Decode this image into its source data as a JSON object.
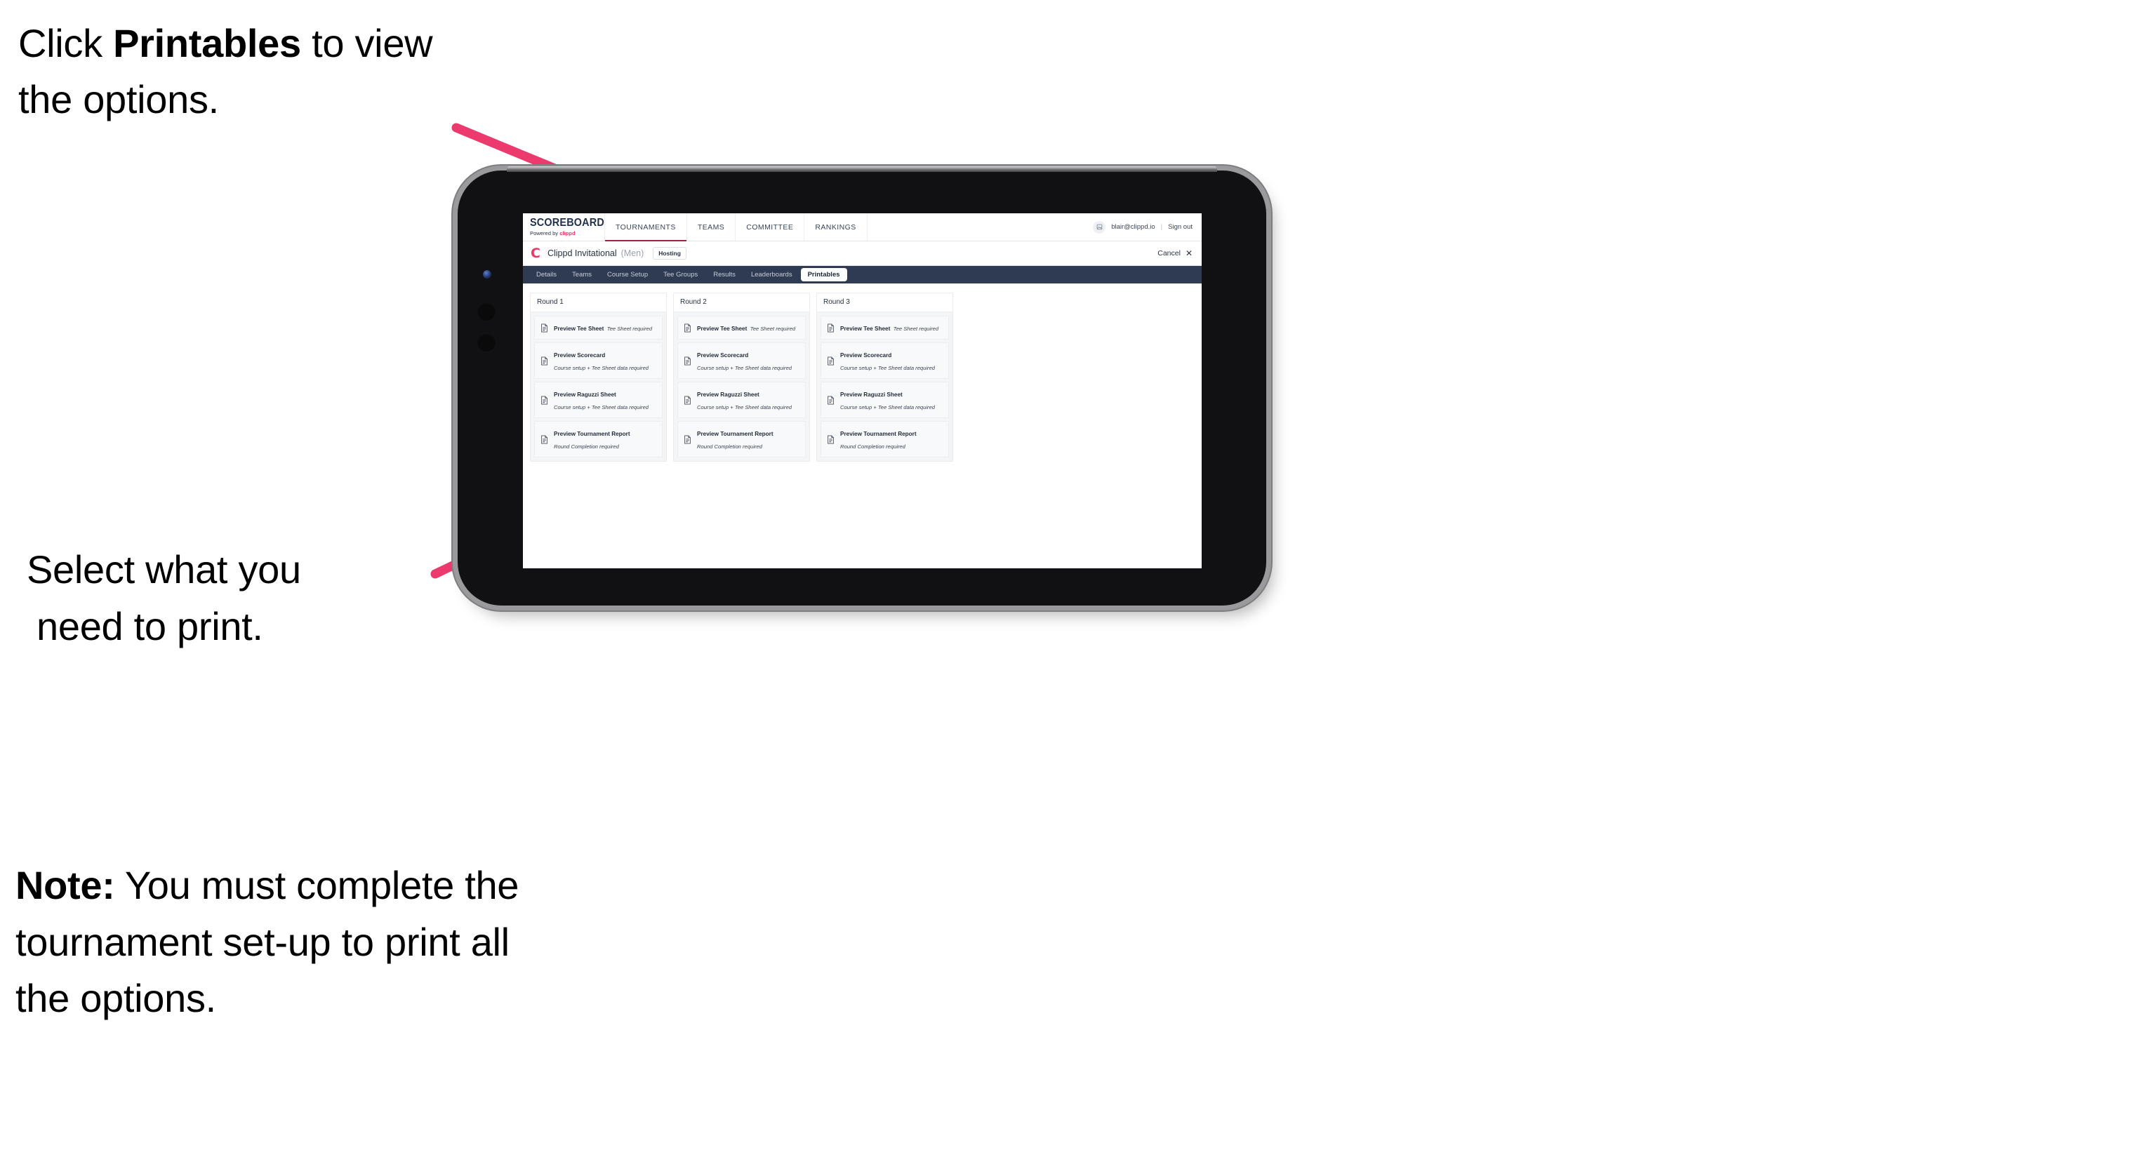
{
  "annotations": {
    "click_printables": {
      "pre": "Click ",
      "bold": "Printables",
      "post": " to view the options."
    },
    "select_print": {
      "line1": "Select what you",
      "line2": "need to print."
    },
    "note": {
      "bold": "Note:",
      "text": " You must complete the tournament set-up to print all the options."
    }
  },
  "app": {
    "brand": {
      "title": "SCOREBOARD",
      "powered_prefix": "Powered by ",
      "powered_brand": "clippd"
    },
    "topnav": [
      {
        "label": "TOURNAMENTS",
        "active": true
      },
      {
        "label": "TEAMS",
        "active": false
      },
      {
        "label": "COMMITTEE",
        "active": false
      },
      {
        "label": "RANKINGS",
        "active": false
      }
    ],
    "account": {
      "avatar_icon": "user-avatar-icon",
      "email": "blair@clippd.io",
      "separator": "|",
      "sign_out": "Sign out"
    },
    "subheader": {
      "logo_letter": "C",
      "tournament_name": "Clippd Invitational",
      "gender": "(Men)",
      "status_badge": "Hosting",
      "cancel_label": "Cancel",
      "cancel_icon": "close-x-icon"
    },
    "tabs": [
      {
        "label": "Details",
        "active": false
      },
      {
        "label": "Teams",
        "active": false
      },
      {
        "label": "Course Setup",
        "active": false
      },
      {
        "label": "Tee Groups",
        "active": false
      },
      {
        "label": "Results",
        "active": false
      },
      {
        "label": "Leaderboards",
        "active": false
      },
      {
        "label": "Printables",
        "active": true
      }
    ],
    "rounds": [
      {
        "header": "Round 1",
        "items": [
          {
            "title": "Preview Tee Sheet",
            "subtitle": "Tee Sheet required",
            "icon": "document-icon"
          },
          {
            "title": "Preview Scorecard",
            "subtitle": "Course setup + Tee Sheet data required",
            "icon": "document-icon"
          },
          {
            "title": "Preview Raguzzi Sheet",
            "subtitle": "Course setup + Tee Sheet data required",
            "icon": "document-icon"
          },
          {
            "title": "Preview Tournament Report",
            "subtitle": "Round Completion required",
            "icon": "document-icon"
          }
        ]
      },
      {
        "header": "Round 2",
        "items": [
          {
            "title": "Preview Tee Sheet",
            "subtitle": "Tee Sheet required",
            "icon": "document-icon"
          },
          {
            "title": "Preview Scorecard",
            "subtitle": "Course setup + Tee Sheet data required",
            "icon": "document-icon"
          },
          {
            "title": "Preview Raguzzi Sheet",
            "subtitle": "Course setup + Tee Sheet data required",
            "icon": "document-icon"
          },
          {
            "title": "Preview Tournament Report",
            "subtitle": "Round Completion required",
            "icon": "document-icon"
          }
        ]
      },
      {
        "header": "Round 3",
        "items": [
          {
            "title": "Preview Tee Sheet",
            "subtitle": "Tee Sheet required",
            "icon": "document-icon"
          },
          {
            "title": "Preview Scorecard",
            "subtitle": "Course setup + Tee Sheet data required",
            "icon": "document-icon"
          },
          {
            "title": "Preview Raguzzi Sheet",
            "subtitle": "Course setup + Tee Sheet data required",
            "icon": "document-icon"
          },
          {
            "title": "Preview Tournament Report",
            "subtitle": "Round Completion required",
            "icon": "document-icon"
          }
        ]
      }
    ]
  },
  "colors": {
    "accent_pink": "#E8396B",
    "arrow_pink": "#EC3A6E",
    "nav_dark": "#2F3B52",
    "active_underline": "#9B2743",
    "text_dark": "#27303F",
    "panel_bg": "#F4F5F7"
  }
}
